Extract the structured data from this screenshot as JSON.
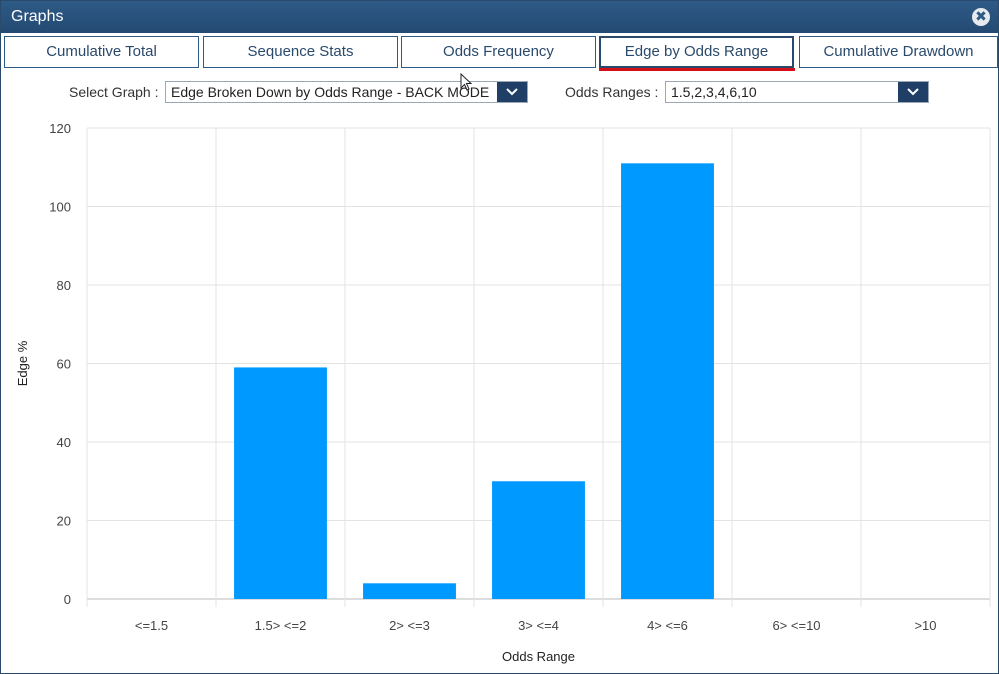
{
  "window": {
    "title": "Graphs",
    "close_glyph": "✖"
  },
  "tabs": [
    {
      "label": "Cumulative Total",
      "active": false
    },
    {
      "label": "Sequence Stats",
      "active": false
    },
    {
      "label": "Odds Frequency",
      "active": false
    },
    {
      "label": "Edge by Odds Range",
      "active": true
    },
    {
      "label": "Cumulative Drawdown",
      "active": false
    }
  ],
  "controls": {
    "select_graph_label": "Select Graph :",
    "select_graph_value": "Edge Broken Down by Odds Range - BACK MODE",
    "odds_ranges_label": "Odds Ranges :",
    "odds_ranges_value": "1.5,2,3,4,6,10"
  },
  "colors": {
    "accent": "#2e5a87",
    "bar": "#0099ff",
    "active_tab_indicator": "#d3101a"
  },
  "chart_data": {
    "type": "bar",
    "categories": [
      "<=1.5",
      "1.5> <=2",
      "2> <=3",
      "3> <=4",
      "4> <=6",
      "6> <=10",
      ">10"
    ],
    "values": [
      0,
      59,
      4,
      30,
      111,
      0,
      0
    ],
    "xlabel": "Odds Range",
    "ylabel": "Edge %",
    "ylim": [
      0,
      120
    ],
    "yticks": [
      0,
      20,
      40,
      60,
      80,
      100,
      120
    ],
    "grid": true,
    "legend": "none"
  }
}
